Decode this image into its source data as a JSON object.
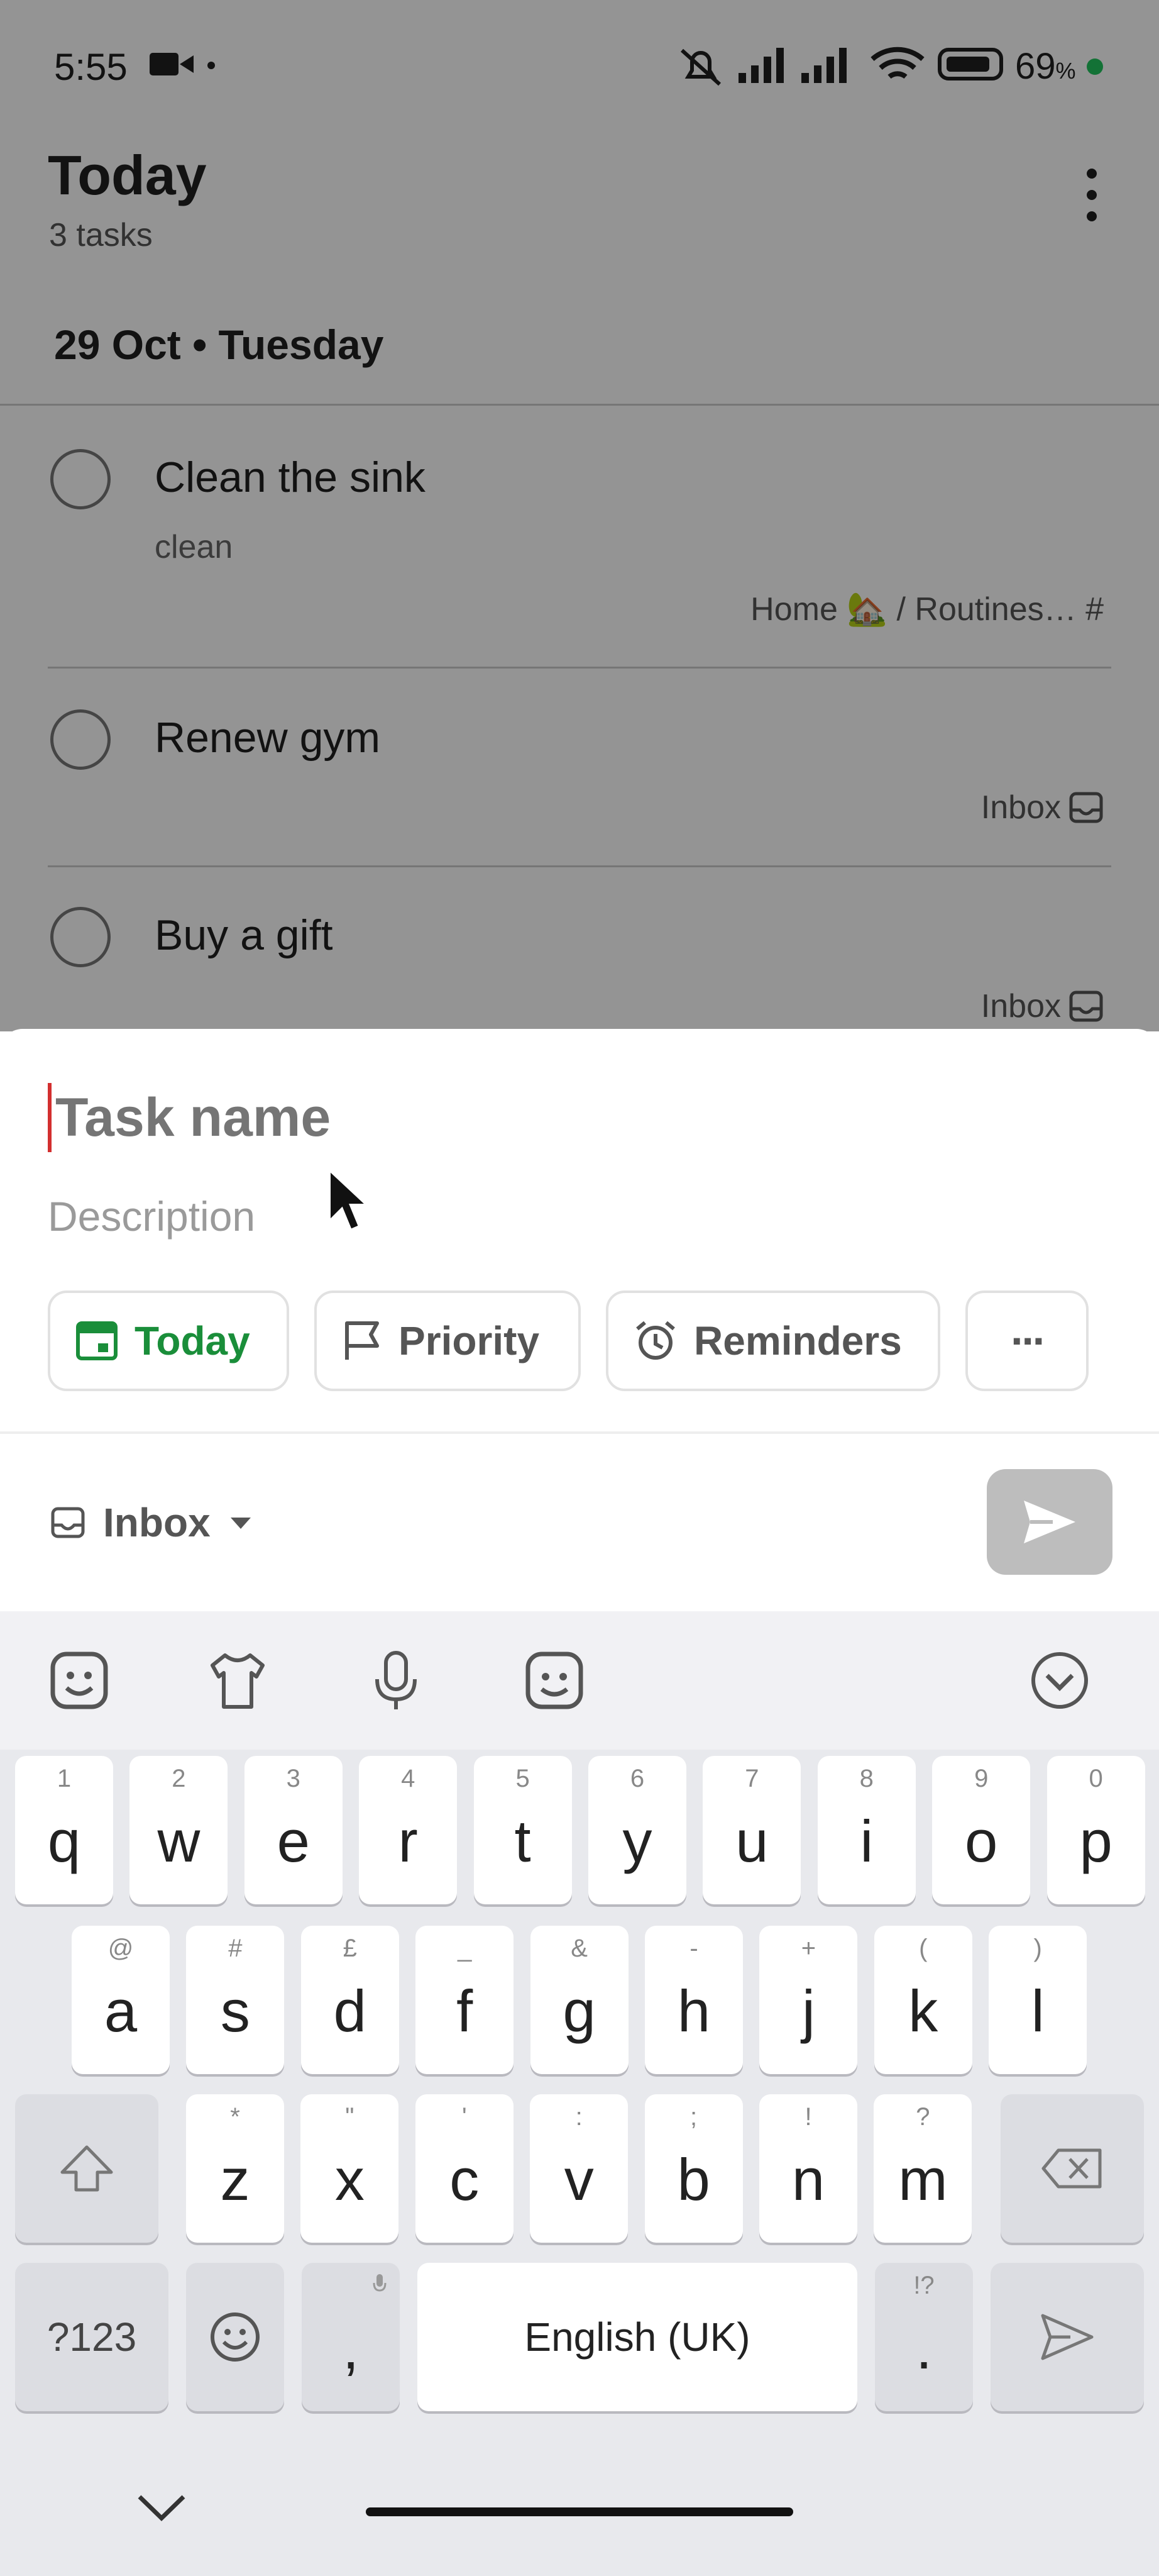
{
  "status_bar": {
    "time": "5:55",
    "battery": "69"
  },
  "header": {
    "title": "Today",
    "subtitle": "3 tasks"
  },
  "section": {
    "date": "29 Oct • Tuesday"
  },
  "tasks": [
    {
      "title": "Clean the sink",
      "description": "clean",
      "project": "Home 🏡 / Routines… #"
    },
    {
      "title": "Renew gym",
      "description": "",
      "project": "Inbox"
    },
    {
      "title": "Buy a gift",
      "description": "",
      "project": "Inbox"
    }
  ],
  "quick_add": {
    "task_name_placeholder": "Task name",
    "description_placeholder": "Description",
    "chips": {
      "today": "Today",
      "priority": "Priority",
      "reminders": "Reminders",
      "more": "···"
    },
    "project": "Inbox"
  },
  "keyboard": {
    "row1": [
      {
        "k": "q",
        "h": "1"
      },
      {
        "k": "w",
        "h": "2"
      },
      {
        "k": "e",
        "h": "3"
      },
      {
        "k": "r",
        "h": "4"
      },
      {
        "k": "t",
        "h": "5"
      },
      {
        "k": "y",
        "h": "6"
      },
      {
        "k": "u",
        "h": "7"
      },
      {
        "k": "i",
        "h": "8"
      },
      {
        "k": "o",
        "h": "9"
      },
      {
        "k": "p",
        "h": "0"
      }
    ],
    "row2": [
      {
        "k": "a",
        "h": "@"
      },
      {
        "k": "s",
        "h": "#"
      },
      {
        "k": "d",
        "h": "£"
      },
      {
        "k": "f",
        "h": "_"
      },
      {
        "k": "g",
        "h": "&"
      },
      {
        "k": "h",
        "h": "-"
      },
      {
        "k": "j",
        "h": "+"
      },
      {
        "k": "k",
        "h": "("
      },
      {
        "k": "l",
        "h": ")"
      }
    ],
    "row3": [
      {
        "k": "z",
        "h": "*"
      },
      {
        "k": "x",
        "h": "\""
      },
      {
        "k": "c",
        "h": "'"
      },
      {
        "k": "v",
        "h": ":"
      },
      {
        "k": "b",
        "h": ";"
      },
      {
        "k": "n",
        "h": "!"
      },
      {
        "k": "m",
        "h": "?"
      }
    ],
    "symbols_key": "?123",
    "comma": ",",
    "space": "English (UK)",
    "period": ".",
    "period_hint": "!?"
  },
  "colors": {
    "accent_green": "#1a8e3a",
    "caret_red": "#d32f2f",
    "send_disabled": "#bdbdbd"
  }
}
